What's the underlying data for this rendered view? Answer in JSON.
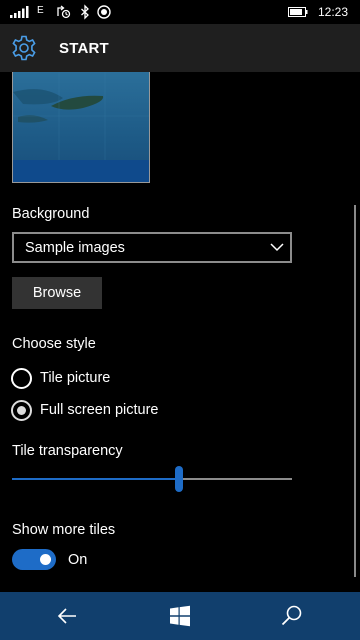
{
  "status": {
    "network": "E",
    "time": "12:23"
  },
  "header": {
    "title": "START"
  },
  "background": {
    "label": "Background",
    "dropdown_value": "Sample images"
  },
  "browse_button": "Browse",
  "style": {
    "label": "Choose style",
    "options": [
      {
        "label": "Tile picture",
        "selected": false
      },
      {
        "label": "Full screen picture",
        "selected": true
      }
    ]
  },
  "transparency": {
    "label": "Tile transparency",
    "value_fraction": 0.595
  },
  "more_tiles": {
    "label": "Show more tiles",
    "state": "On"
  },
  "colors": {
    "accent": "#1e6cc7",
    "header_bg": "#1f1f1f",
    "navbar_bg": "#113f6d"
  },
  "icons": {
    "header": "gear-icon",
    "nav": [
      "back-arrow-icon",
      "windows-logo-icon",
      "search-icon"
    ]
  }
}
